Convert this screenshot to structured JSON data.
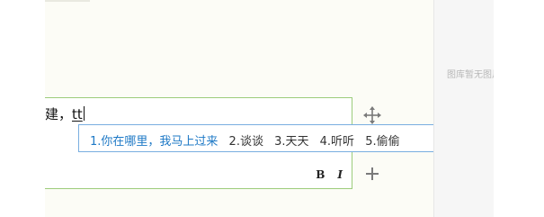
{
  "editor": {
    "committed_text": "建，",
    "typed_text": "tt"
  },
  "ime": {
    "candidates": [
      "1.你在哪里，我马上过来",
      "2.谈谈",
      "3.天天",
      "4.听听",
      "5.偷偷"
    ]
  },
  "format_bar": {
    "bold_label": "B",
    "italic_label": "I"
  },
  "gallery": {
    "empty_text": "图库暂无图片"
  },
  "colors": {
    "editor_border": "#9ccc7b",
    "ime_border": "#79aee0",
    "candidate_selected": "#1e79c6"
  },
  "icons": {
    "move": "move-arrows-icon",
    "add": "plus-icon"
  }
}
